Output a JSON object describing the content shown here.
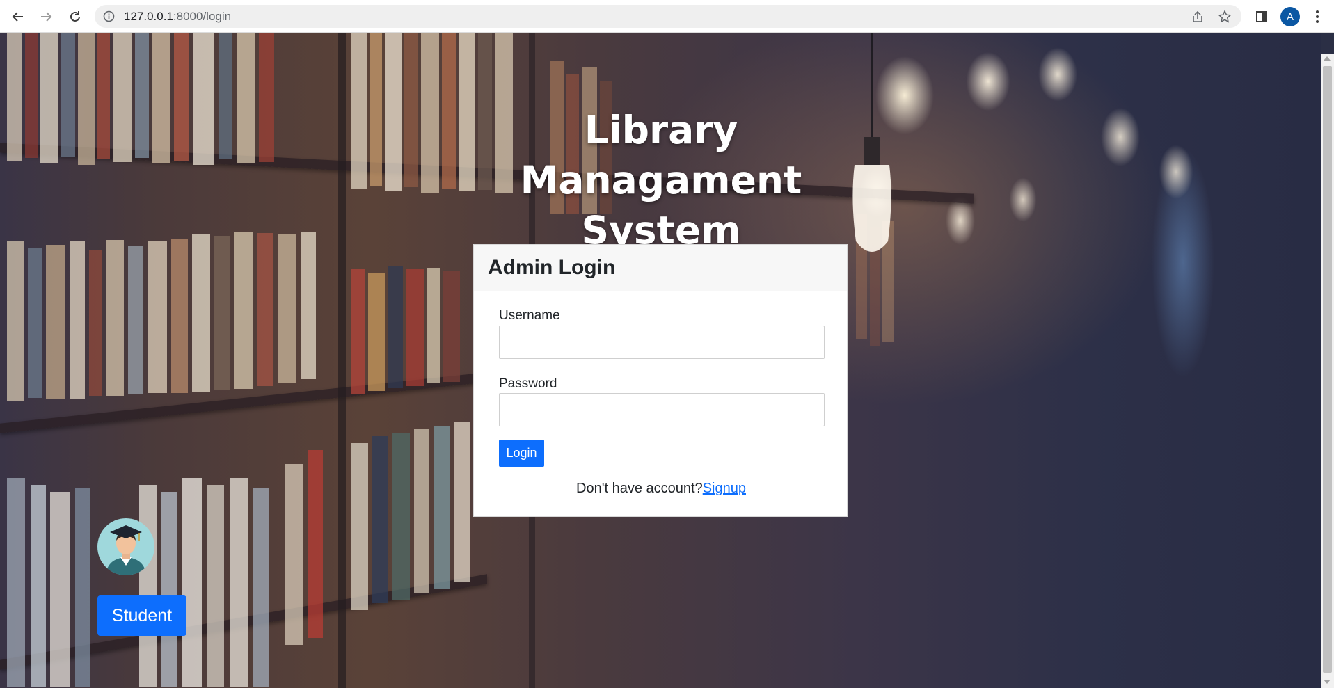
{
  "browser": {
    "url_host": "127.0.0.1",
    "url_rest": ":8000/login",
    "profile_initial": "A",
    "icons": [
      "back-arrow-icon",
      "forward-arrow-icon",
      "reload-icon",
      "info-icon",
      "share-icon",
      "star-icon",
      "side-panel-icon",
      "menu-kebab-icon"
    ]
  },
  "page": {
    "title_line1": "Library Managament",
    "title_line2": "System"
  },
  "login_card": {
    "title": "Admin Login",
    "username_label": "Username",
    "username_value": "",
    "password_label": "Password",
    "password_value": "",
    "login_label": "Login",
    "signup_prompt": "Don't have account?",
    "signup_link": "Signup"
  },
  "student": {
    "button_label": "Student"
  },
  "colors": {
    "primary": "#0d6efd",
    "card_header_bg": "#f7f7f7",
    "avatar_bg": "#9fd8dc",
    "profile_bg": "#0b57a3"
  }
}
